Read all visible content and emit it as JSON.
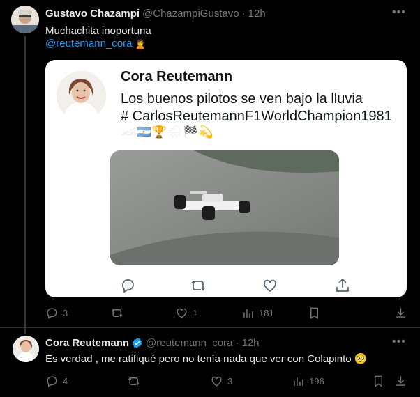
{
  "tweets": [
    {
      "name": "Gustavo Chazampi",
      "handle": "@ChazampiGustavo",
      "dot": "·",
      "time": "12h",
      "text": "Muchachita inoportuna",
      "mention": "@reutemann_cora",
      "mention_emoji": "🙎",
      "stats": {
        "replies": "3",
        "retweets": "",
        "likes": "1",
        "views": "181"
      }
    },
    {
      "name": "Cora Reutemann",
      "handle": "@reutemann_cora",
      "dot": "·",
      "time": "12h",
      "text": "Es verdad , me ratifiqué pero no tenía nada que ver con Colapinto 🥺",
      "stats": {
        "replies": "4",
        "retweets": "",
        "likes": "3",
        "views": "196"
      }
    }
  ],
  "card": {
    "name": "Cora Reutemann",
    "line1": "Los buenos pilotos se ven bajo la lluvia",
    "line2": "# CarlosReutemannF1WorldChampion1981",
    "emojis": "🏎🇦🇷🏆🌧🏁💫"
  },
  "colors": {
    "accent": "#1d9bf0",
    "muted": "#71767b",
    "text": "#e7e9ea",
    "background": "#000000"
  },
  "icons": [
    "more-icon",
    "verified-badge-icon",
    "reply-icon",
    "retweet-icon",
    "like-icon",
    "views-icon",
    "bookmark-icon",
    "share-icon"
  ]
}
